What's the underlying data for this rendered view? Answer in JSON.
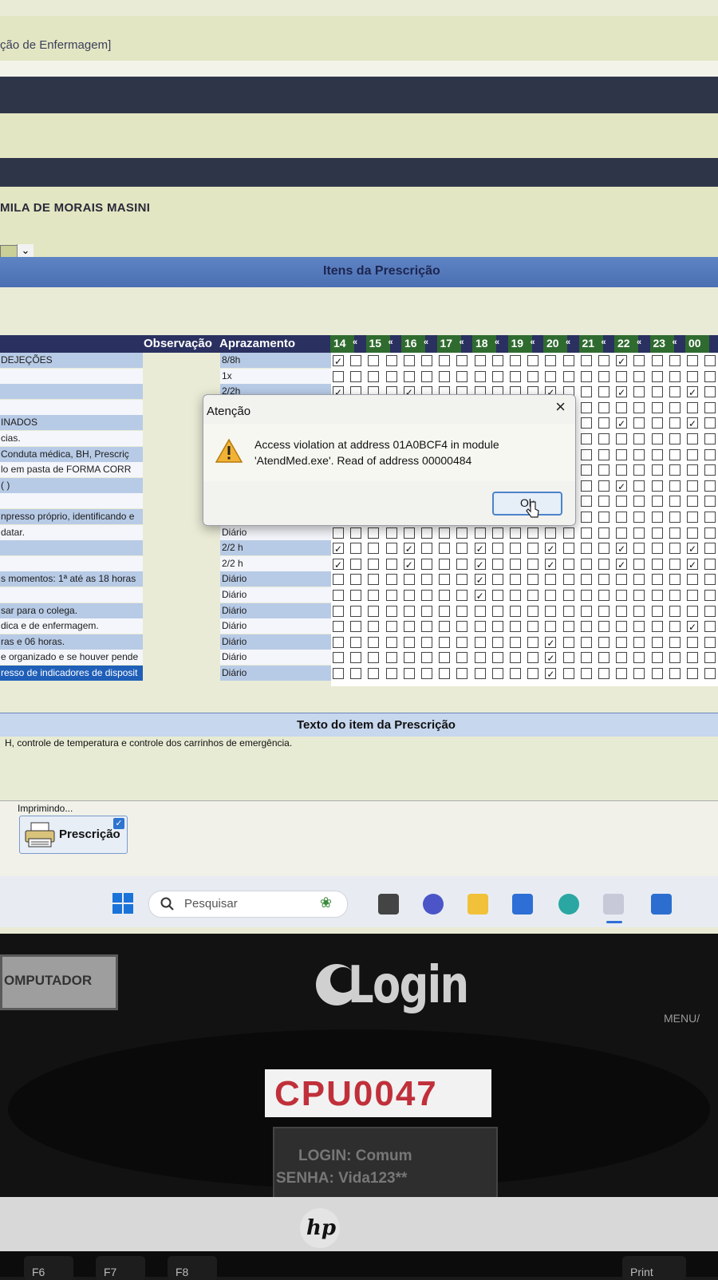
{
  "window": {
    "title_fragment": "ção de Enfermagem]",
    "patient_name": "MILA DE MORAIS MASINI"
  },
  "prescription": {
    "section_title": "Itens da Prescrição",
    "column_observacao": "Observação",
    "column_aprazamento": "Aprazamento",
    "hours": [
      "14",
      "15",
      "16",
      "17",
      "18",
      "19",
      "20",
      "21",
      "22",
      "23",
      "00"
    ],
    "hour_separator": "«",
    "rows": [
      {
        "item": "DEJEÇÕES",
        "aprazamento": "8/8h",
        "style": "blue"
      },
      {
        "item": "",
        "aprazamento": "1x",
        "style": "white"
      },
      {
        "item": "",
        "aprazamento": "2/2h",
        "style": "blue"
      },
      {
        "item": "",
        "aprazamento": "",
        "style": "white"
      },
      {
        "item": "INADOS",
        "aprazamento": "",
        "style": "blue"
      },
      {
        "item": "cias.",
        "aprazamento": "",
        "style": "white"
      },
      {
        "item": "Conduta médica, BH, Prescriç",
        "aprazamento": "",
        "style": "blue"
      },
      {
        "item": "lo em pasta de FORMA CORR",
        "aprazamento": "",
        "style": "white"
      },
      {
        "item": "( )",
        "aprazamento": "",
        "style": "blue"
      },
      {
        "item": "",
        "aprazamento": "",
        "style": "white"
      },
      {
        "item": "npresso próprio, identificando e",
        "aprazamento": "Diário",
        "style": "blue"
      },
      {
        "item": "datar.",
        "aprazamento": "Diário",
        "style": "white"
      },
      {
        "item": "",
        "aprazamento": "2/2 h",
        "style": "blue"
      },
      {
        "item": "",
        "aprazamento": "2/2 h",
        "style": "white"
      },
      {
        "item": "s momentos: 1ª até as 18 horas",
        "aprazamento": "Diário",
        "style": "blue"
      },
      {
        "item": "",
        "aprazamento": "Diário",
        "style": "white"
      },
      {
        "item": "sar para o colega.",
        "aprazamento": "Diário",
        "style": "blue"
      },
      {
        "item": "dica e de enfermagem.",
        "aprazamento": "Diário",
        "style": "white"
      },
      {
        "item": "ras e 06 horas.",
        "aprazamento": "Diário",
        "style": "blue"
      },
      {
        "item": "e organizado e se houver pende",
        "aprazamento": "Diário",
        "style": "white"
      },
      {
        "item": "resso de indicadores de disposit",
        "aprazamento": "Diário",
        "style": "sel"
      }
    ],
    "checks": [
      [
        0,
        0
      ],
      [
        0,
        16
      ],
      [
        2,
        0
      ],
      [
        2,
        4
      ],
      [
        2,
        12
      ],
      [
        2,
        16
      ],
      [
        2,
        20
      ],
      [
        4,
        16
      ],
      [
        4,
        20
      ],
      [
        8,
        16
      ],
      [
        12,
        0
      ],
      [
        12,
        4
      ],
      [
        12,
        8
      ],
      [
        12,
        12
      ],
      [
        12,
        16
      ],
      [
        12,
        20
      ],
      [
        13,
        0
      ],
      [
        13,
        4
      ],
      [
        13,
        8
      ],
      [
        13,
        12
      ],
      [
        13,
        16
      ],
      [
        13,
        20
      ],
      [
        14,
        8
      ],
      [
        15,
        8
      ],
      [
        17,
        20
      ],
      [
        18,
        12
      ],
      [
        19,
        12
      ],
      [
        20,
        12
      ]
    ]
  },
  "item_text": {
    "title": "Texto do item da Prescrição",
    "body": "H, controle de temperatura e controle dos carrinhos de emergência."
  },
  "printing": {
    "status": "Imprimindo...",
    "button_label": "Prescrição"
  },
  "taskbar": {
    "search_placeholder": "Pesquisar"
  },
  "dialog": {
    "title": "Atenção",
    "message_line1": "Access violation at address 01A0BCF4 in module",
    "message_line2": "'AtendMed.exe'. Read of address 00000484",
    "ok_label": "Ok"
  },
  "hardware": {
    "asset_sticker": "OMPUTADOR",
    "monitor_brand": "Login",
    "menu_label": "MENU/",
    "cpu_label": "CPU0047",
    "login_card_line1": "LOGIN: Comum",
    "login_card_line2": "SENHA: Vida123**",
    "keys": [
      "F6",
      "F7",
      "F8",
      "Print"
    ]
  }
}
